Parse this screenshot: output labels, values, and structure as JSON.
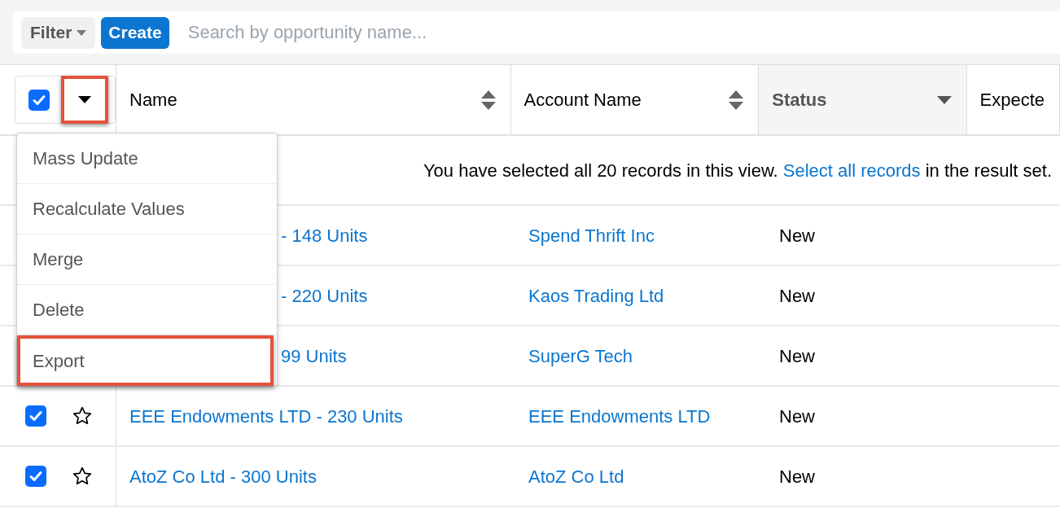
{
  "toolbar": {
    "filter_label": "Filter",
    "create_label": "Create",
    "search": {
      "placeholder": "Search by opportunity name..."
    }
  },
  "select_all": {
    "checked": true,
    "highlighted": true
  },
  "columns": [
    {
      "label": "Name",
      "sorted": false
    },
    {
      "label": "Account Name",
      "sorted": false
    },
    {
      "label": "Status",
      "sorted": true
    },
    {
      "label": "Expecte",
      "sorted": false
    }
  ],
  "notice": {
    "before": "You have selected all 20 records in this view.",
    "link": "Select all records",
    "after": "in the result set."
  },
  "actions_menu": [
    {
      "label": "Mass Update",
      "highlighted": false
    },
    {
      "label": "Recalculate Values",
      "highlighted": false
    },
    {
      "label": "Merge",
      "highlighted": false
    },
    {
      "label": "Delete",
      "highlighted": false
    },
    {
      "label": "Export",
      "highlighted": true
    }
  ],
  "rows": [
    {
      "name": "- 148 Units",
      "partial": true,
      "account": "Spend Thrift Inc",
      "status": "New"
    },
    {
      "name": "- 220 Units",
      "partial": true,
      "account": "Kaos Trading Ltd",
      "status": "New"
    },
    {
      "name": "99 Units",
      "partial": true,
      "account": "SuperG Tech",
      "status": "New"
    },
    {
      "name": "EEE Endowments LTD - 230 Units",
      "partial": false,
      "checked": true,
      "favorite": false,
      "account": "EEE Endowments LTD",
      "status": "New"
    },
    {
      "name": "AtoZ Co Ltd - 300 Units",
      "partial": false,
      "checked": true,
      "favorite": false,
      "account": "AtoZ Co Ltd",
      "status": "New"
    }
  ]
}
